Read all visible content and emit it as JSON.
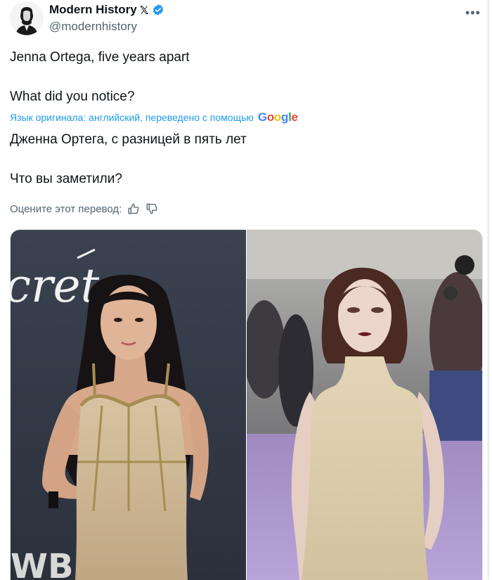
{
  "author": {
    "display_name": "Modern History",
    "x_badge": "𝕏",
    "handle": "@modernhistory"
  },
  "tweet": {
    "line1": "Jenna Ortega, five years apart",
    "line2": "What did you notice?"
  },
  "translation": {
    "notice": "Язык оригинала: английский, переведено с помощью",
    "provider": "Google",
    "line1": "Дженна Ортега, с разницей в пять лет",
    "line2": "Что вы заметили?",
    "rate_prompt": "Оцените этот перевод:"
  },
  "icons": {
    "more": "more-icon",
    "verified": "verified-icon",
    "thumbs_up": "thumbs-up-icon",
    "thumbs_down": "thumbs-down-icon"
  },
  "colors": {
    "accent": "#1d9bf0",
    "secondary_text": "#536471",
    "google_blue": "#4285f4",
    "google_red": "#ea4335",
    "google_yellow": "#fbbc05",
    "google_green": "#34a853"
  },
  "media": {
    "left_logo_text": "cret",
    "left_sponsor": "WB"
  }
}
